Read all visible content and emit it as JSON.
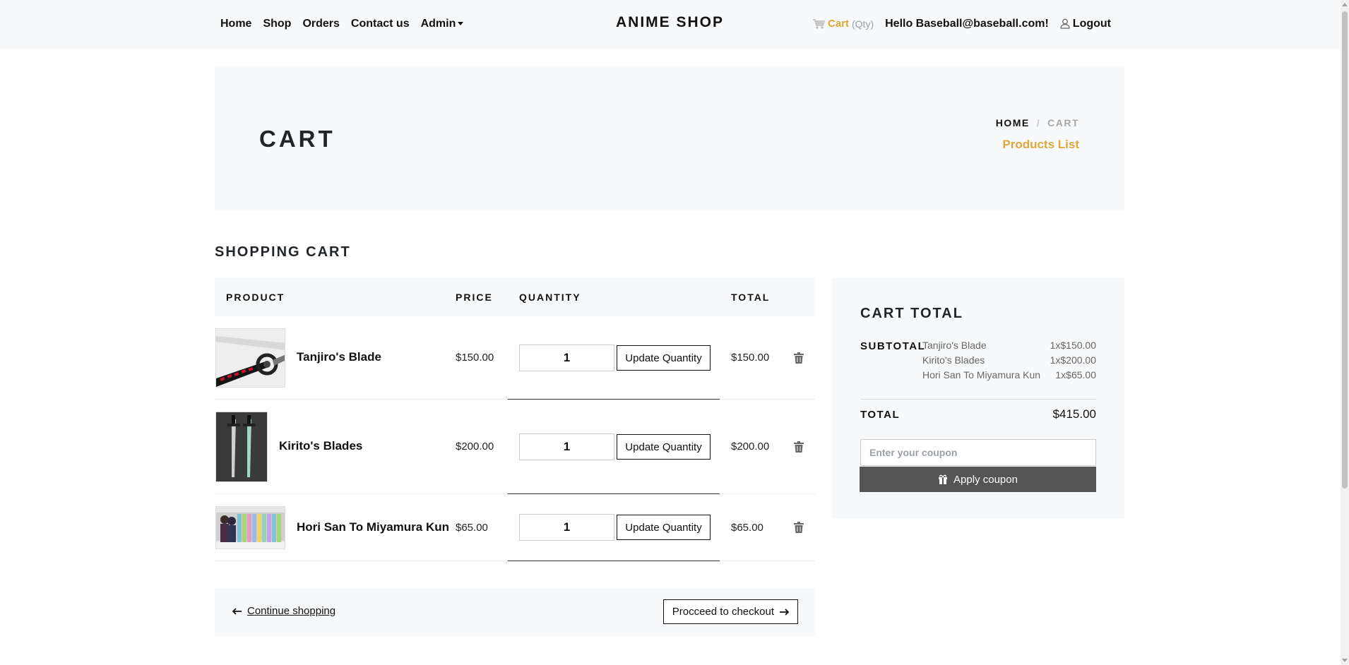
{
  "nav": {
    "home": "Home",
    "shop": "Shop",
    "orders": "Orders",
    "contact": "Contact us",
    "admin": "Admin",
    "brand": "ANIME SHOP",
    "cart": "Cart",
    "cart_qty": "(Qty)",
    "hello": "Hello Baseball@baseball.com!",
    "logout": "Logout"
  },
  "hero": {
    "title": "CART",
    "breadcrumb_home": "HOME",
    "breadcrumb_sep": "/",
    "breadcrumb_current": "CART",
    "products_list": "Products List"
  },
  "section_title": "SHOPPING CART",
  "table": {
    "headers": {
      "product": "PRODUCT",
      "price": "PRICE",
      "quantity": "QUANTITY",
      "total": "TOTAL"
    },
    "update_label": "Update Quantity",
    "rows": [
      {
        "name": "Tanjiro's Blade",
        "price": "$150.00",
        "qty": "1",
        "total": "$150.00"
      },
      {
        "name": "Kirito's Blades",
        "price": "$200.00",
        "qty": "1",
        "total": "$200.00"
      },
      {
        "name": "Hori San To Miyamura Kun",
        "price": "$65.00",
        "qty": "1",
        "total": "$65.00"
      }
    ]
  },
  "footer": {
    "continue": "Continue shopping",
    "checkout": "Procceed to checkout"
  },
  "totals": {
    "title": "CART TOTAL",
    "subtotal_label": "SUBTOTAL",
    "items": [
      {
        "name": "Tanjiro's Blade",
        "amount": "1x$150.00"
      },
      {
        "name": "Kirito's Blades",
        "amount": "1x$200.00"
      },
      {
        "name": "Hori San To Miyamura Kun",
        "amount": "1x$65.00"
      }
    ],
    "total_label": "TOTAL",
    "total_value": "$415.00",
    "coupon_placeholder": "Enter your coupon",
    "apply_label": "Apply coupon"
  },
  "colors": {
    "accent": "#dba83a",
    "panel": "#f8f9fa",
    "button_dark": "#555555"
  }
}
